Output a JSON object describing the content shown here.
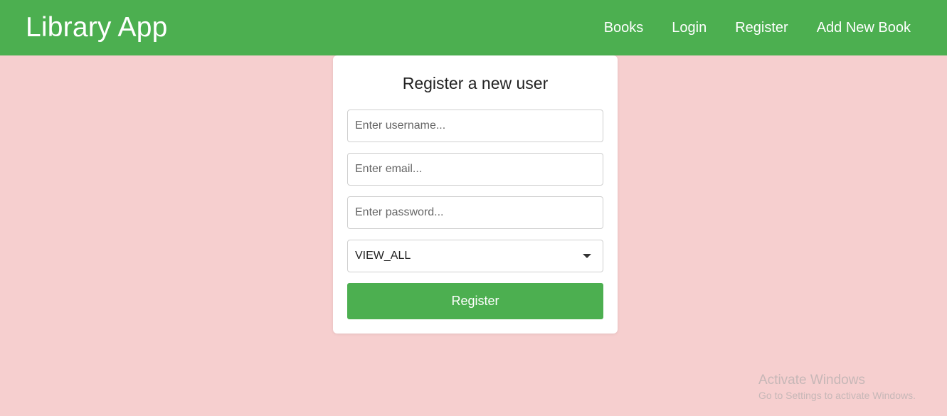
{
  "navbar": {
    "brand": "Library App",
    "links": [
      {
        "label": "Books"
      },
      {
        "label": "Login"
      },
      {
        "label": "Register"
      },
      {
        "label": "Add New Book"
      }
    ],
    "color": "#4caf50"
  },
  "form": {
    "title": "Register a new user",
    "username": {
      "placeholder": "Enter username...",
      "value": ""
    },
    "email": {
      "placeholder": "Enter email...",
      "value": ""
    },
    "password": {
      "placeholder": "Enter password...",
      "value": ""
    },
    "role_select": {
      "selected": "VIEW_ALL"
    },
    "submit_label": "Register"
  },
  "watermark": {
    "title": "Activate Windows",
    "subtitle": "Go to Settings to activate Windows."
  },
  "colors": {
    "background": "#f6cfcf",
    "accent": "#4caf50"
  }
}
